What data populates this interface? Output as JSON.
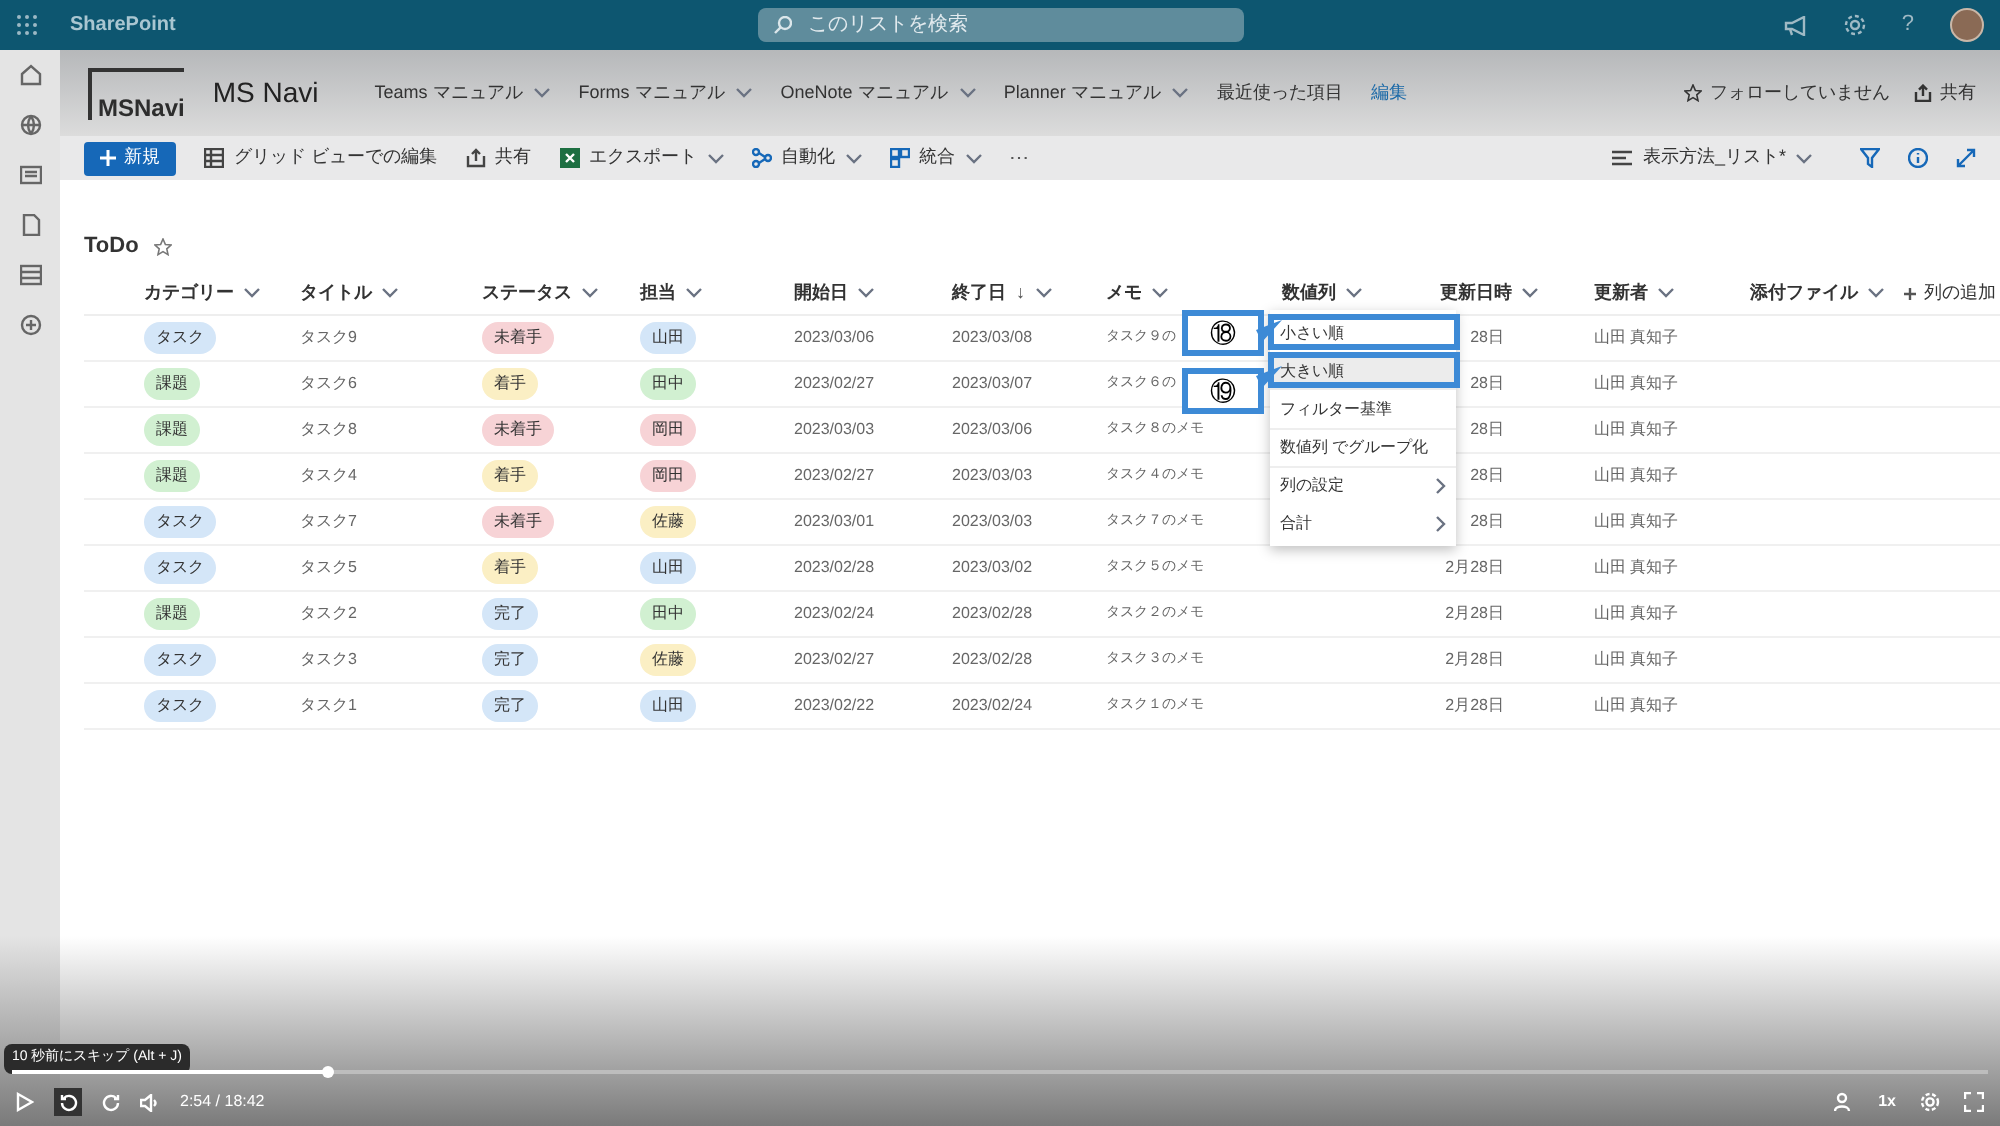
{
  "suite_bar": {
    "app_name": "SharePoint",
    "search_placeholder": "このリストを検索",
    "help": "?"
  },
  "site_header": {
    "logo_text": "MSNavi",
    "site_title": "MS Navi",
    "nav": [
      {
        "label": "Teams マニュアル",
        "dropdown": true
      },
      {
        "label": "Forms マニュアル",
        "dropdown": true
      },
      {
        "label": "OneNote マニュアル",
        "dropdown": true
      },
      {
        "label": "Planner マニュアル",
        "dropdown": true
      },
      {
        "label": "最近使った項目",
        "dropdown": false
      },
      {
        "label": "編集",
        "dropdown": false,
        "kind": "link"
      }
    ],
    "follow": "フォローしていません",
    "share": "共有"
  },
  "command_bar": {
    "new_button": "新規",
    "items": [
      {
        "label": "グリッド ビューでの編集",
        "dropdown": false
      },
      {
        "label": "共有",
        "dropdown": false
      },
      {
        "label": "エクスポート",
        "dropdown": true
      },
      {
        "label": "自動化",
        "dropdown": true
      },
      {
        "label": "統合",
        "dropdown": true
      }
    ],
    "more": "⋯",
    "view": "表示方法_リスト*"
  },
  "list": {
    "title": "ToDo",
    "columns": [
      {
        "label": "カテゴリー"
      },
      {
        "label": "タイトル"
      },
      {
        "label": "ステータス"
      },
      {
        "label": "担当"
      },
      {
        "label": "開始日"
      },
      {
        "label": "終了日",
        "sort": "↓"
      },
      {
        "label": "メモ"
      },
      {
        "label": "数値列"
      },
      {
        "label": "更新日時"
      },
      {
        "label": "更新者"
      },
      {
        "label": "添付ファイル"
      }
    ],
    "add_column": "列の追加",
    "rows": [
      {
        "category": {
          "text": "タスク",
          "color": "#d4e6f8"
        },
        "title": "タスク9",
        "status": {
          "text": "未着手",
          "color": "#f7d3d6"
        },
        "assignee": {
          "text": "山田",
          "color": "#d4e6f8"
        },
        "start": "2023/03/06",
        "end": "2023/03/08",
        "memo": "タスク９の",
        "updated": "28日",
        "updated_by": "山田 真知子"
      },
      {
        "category": {
          "text": "課題",
          "color": "#d1f0d1"
        },
        "title": "タスク6",
        "status": {
          "text": "着手",
          "color": "#fbefc4"
        },
        "assignee": {
          "text": "田中",
          "color": "#d1f0d1"
        },
        "start": "2023/02/27",
        "end": "2023/03/07",
        "memo": "タスク６の",
        "updated": "28日",
        "updated_by": "山田 真知子"
      },
      {
        "category": {
          "text": "課題",
          "color": "#d1f0d1"
        },
        "title": "タスク8",
        "status": {
          "text": "未着手",
          "color": "#f7d3d6"
        },
        "assignee": {
          "text": "岡田",
          "color": "#f7d3d6"
        },
        "start": "2023/03/03",
        "end": "2023/03/06",
        "memo": "タスク８のメモ",
        "updated": "28日",
        "updated_by": "山田 真知子"
      },
      {
        "category": {
          "text": "課題",
          "color": "#d1f0d1"
        },
        "title": "タスク4",
        "status": {
          "text": "着手",
          "color": "#fbefc4"
        },
        "assignee": {
          "text": "岡田",
          "color": "#f7d3d6"
        },
        "start": "2023/02/27",
        "end": "2023/03/03",
        "memo": "タスク４のメモ",
        "updated": "28日",
        "updated_by": "山田 真知子"
      },
      {
        "category": {
          "text": "タスク",
          "color": "#d4e6f8"
        },
        "title": "タスク7",
        "status": {
          "text": "未着手",
          "color": "#f7d3d6"
        },
        "assignee": {
          "text": "佐藤",
          "color": "#fbefc4"
        },
        "start": "2023/03/01",
        "end": "2023/03/03",
        "memo": "タスク７のメモ",
        "updated": "28日",
        "updated_by": "山田 真知子"
      },
      {
        "category": {
          "text": "タスク",
          "color": "#d4e6f8"
        },
        "title": "タスク5",
        "status": {
          "text": "着手",
          "color": "#fbefc4"
        },
        "assignee": {
          "text": "山田",
          "color": "#d4e6f8"
        },
        "start": "2023/02/28",
        "end": "2023/03/02",
        "memo": "タスク５のメモ",
        "updated": "2月28日",
        "updated_by": "山田 真知子"
      },
      {
        "category": {
          "text": "課題",
          "color": "#d1f0d1"
        },
        "title": "タスク2",
        "status": {
          "text": "完了",
          "color": "#d4e6f8"
        },
        "assignee": {
          "text": "田中",
          "color": "#d1f0d1"
        },
        "start": "2023/02/24",
        "end": "2023/02/28",
        "memo": "タスク２のメモ",
        "updated": "2月28日",
        "updated_by": "山田 真知子"
      },
      {
        "category": {
          "text": "タスク",
          "color": "#d4e6f8"
        },
        "title": "タスク3",
        "status": {
          "text": "完了",
          "color": "#d4e6f8"
        },
        "assignee": {
          "text": "佐藤",
          "color": "#fbefc4"
        },
        "start": "2023/02/27",
        "end": "2023/02/28",
        "memo": "タスク３のメモ",
        "updated": "2月28日",
        "updated_by": "山田 真知子"
      },
      {
        "category": {
          "text": "タスク",
          "color": "#d4e6f8"
        },
        "title": "タスク1",
        "status": {
          "text": "完了",
          "color": "#d4e6f8"
        },
        "assignee": {
          "text": "山田",
          "color": "#d4e6f8"
        },
        "start": "2023/02/22",
        "end": "2023/02/24",
        "memo": "タスク１のメモ",
        "updated": "2月28日",
        "updated_by": "山田 真知子"
      }
    ]
  },
  "column_menu": {
    "items": [
      {
        "label": "小さい順",
        "highlighted": false,
        "submenu": false
      },
      {
        "label": "大きい順",
        "highlighted": true,
        "submenu": false
      },
      {
        "label": "フィルター基準",
        "highlighted": false,
        "submenu": false
      },
      {
        "label": "数値列 でグループ化",
        "highlighted": false,
        "submenu": false
      },
      {
        "label": "列の設定",
        "highlighted": false,
        "submenu": true
      },
      {
        "label": "合計",
        "highlighted": false,
        "submenu": true
      }
    ]
  },
  "annotations": [
    {
      "number": "⑱"
    },
    {
      "number": "⑲"
    }
  ],
  "player": {
    "tooltip": "10 秒前にスキップ (Alt + J)",
    "level": 0.16,
    "time": "2:54 / 18:42",
    "speed": "1x"
  }
}
